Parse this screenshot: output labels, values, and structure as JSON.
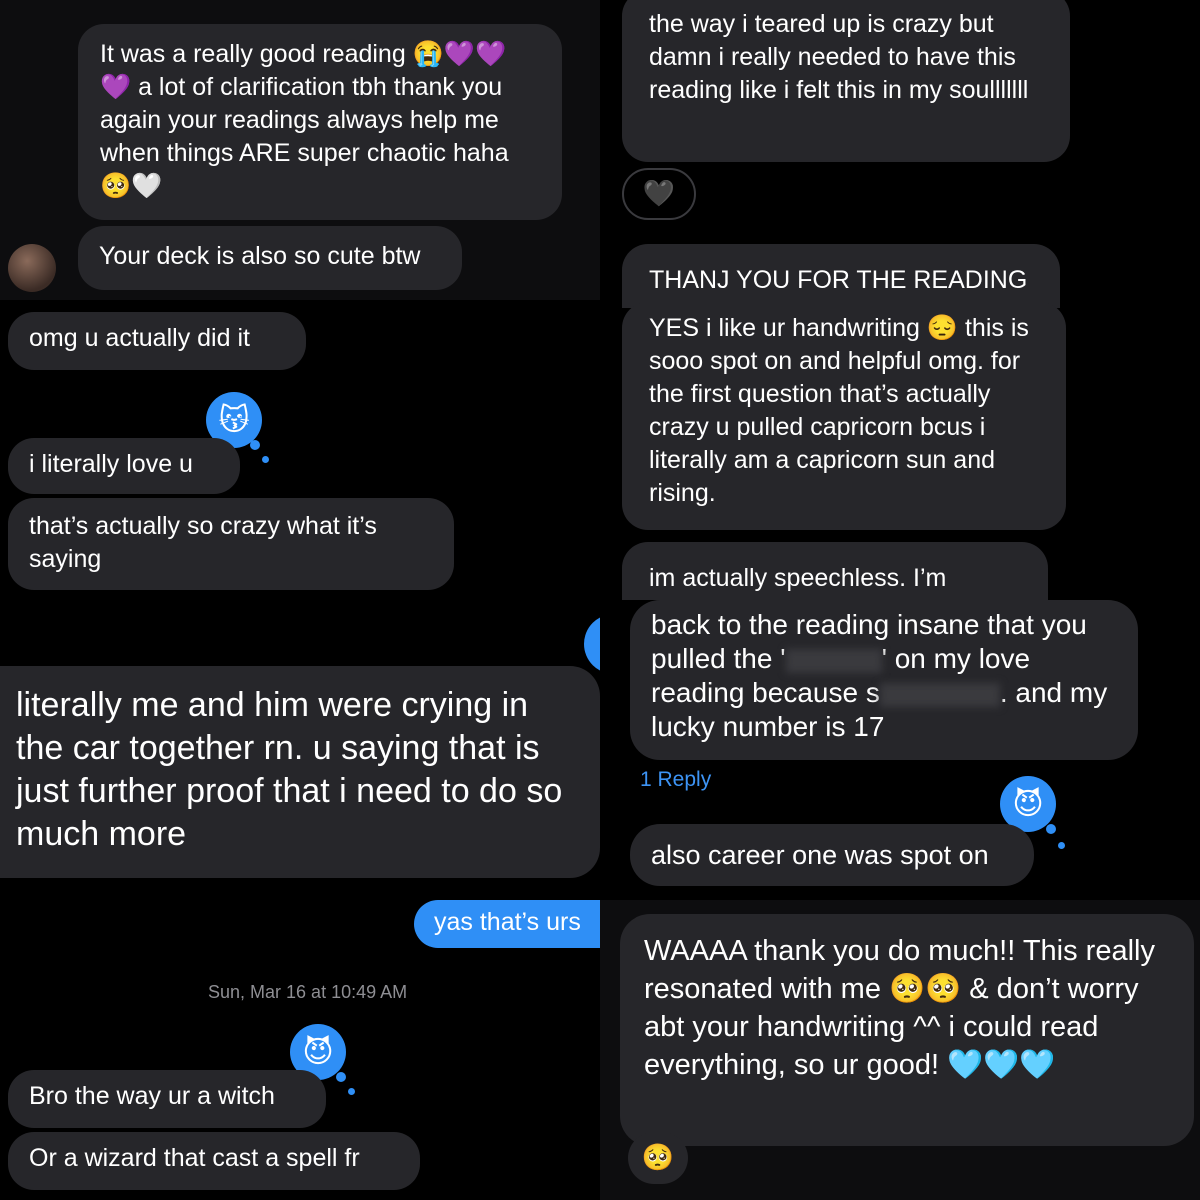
{
  "top_left": {
    "msg1": "It was a really good reading 😭💜💜 💜 a lot of clarification tbh thank you again your readings always help me when things ARE super chaotic haha 🥺🤍",
    "msg2": "Your deck is also so cute btw"
  },
  "mid_left": {
    "msg1": "omg u actually did it",
    "reaction1": "😽",
    "msg2": "i literally love u",
    "msg3": "that’s actually so crazy what it’s saying"
  },
  "center_left": {
    "msg1": "literally me and him were crying in the car together rn. u saying that is just further proof that i need to do so much more"
  },
  "bottom_left": {
    "sent": "yas that’s urs",
    "timestamp": "Sun, Mar 16 at 10:49 AM",
    "reaction": "😈",
    "msg1": "Bro the way ur a witch",
    "msg2": "Or a wizard that cast a spell fr"
  },
  "top_right": {
    "msg1": "the way i teared up is crazy but damn i really needed to have this reading like i felt this in my soulllllll",
    "reaction": "🖤"
  },
  "mid_right": {
    "msg1": "THANJ YOU FOR THE READING",
    "msg2": "YES i like ur handwriting 😔 this is sooo spot on and helpful omg. for the first question that’s actually crazy u pulled capricorn bcus i literally am a capricorn sun and rising.",
    "msg3": "im actually speechless. I’m"
  },
  "center_right": {
    "msg1_a": "back to the reading insane that you pulled the '",
    "msg1_b": "' on my love reading because s",
    "msg1_c": ". and my lucky number is 17",
    "reply_link": "1 Reply",
    "reaction": "😈",
    "msg2": "also career one was spot on"
  },
  "bottom_right": {
    "msg1": "WAAAA thank you do much!! This really resonated with me 🥺🥺 & don’t worry abt your handwriting ^^ i could read everything, so ur good! 🩵🩵🩵",
    "reaction": "🥺"
  }
}
